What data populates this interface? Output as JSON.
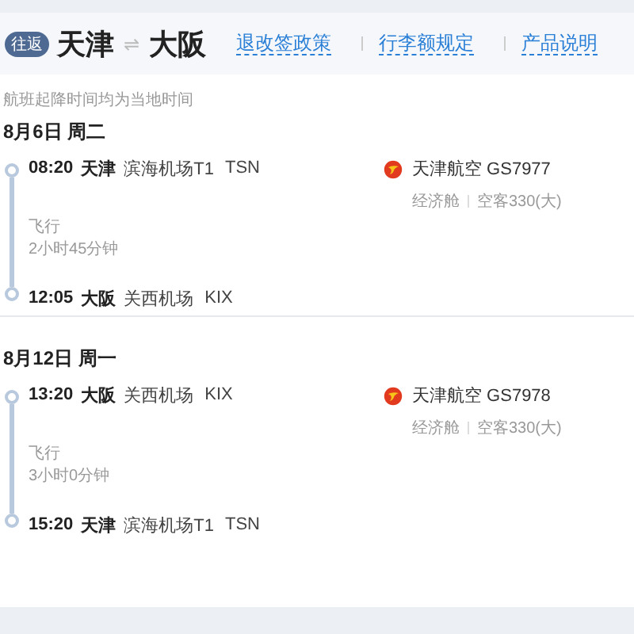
{
  "header": {
    "badge": "往返",
    "from": "天津",
    "swap_icon": "⇌",
    "to": "大阪",
    "links": [
      "退改签政策",
      "行李额规定",
      "产品说明"
    ]
  },
  "note": "航班起降时间均为当地时间",
  "segments": [
    {
      "date": "8月6日 周二",
      "departure": {
        "time": "08:20",
        "city": "天津",
        "airport": "滨海机场T1",
        "code": "TSN"
      },
      "duration_label": "飞行",
      "duration": "2小时45分钟",
      "arrival": {
        "time": "12:05",
        "city": "大阪",
        "airport": "关西机场",
        "code": "KIX"
      },
      "airline": "天津航空 GS7977",
      "cabin": "经济舱",
      "aircraft": "空客330(大)"
    },
    {
      "date": "8月12日 周一",
      "departure": {
        "time": "13:20",
        "city": "大阪",
        "airport": "关西机场",
        "code": "KIX"
      },
      "duration_label": "飞行",
      "duration": "3小时0分钟",
      "arrival": {
        "time": "15:20",
        "city": "天津",
        "airport": "滨海机场T1",
        "code": "TSN"
      },
      "airline": "天津航空 GS7978",
      "cabin": "经济舱",
      "aircraft": "空客330(大)"
    }
  ]
}
